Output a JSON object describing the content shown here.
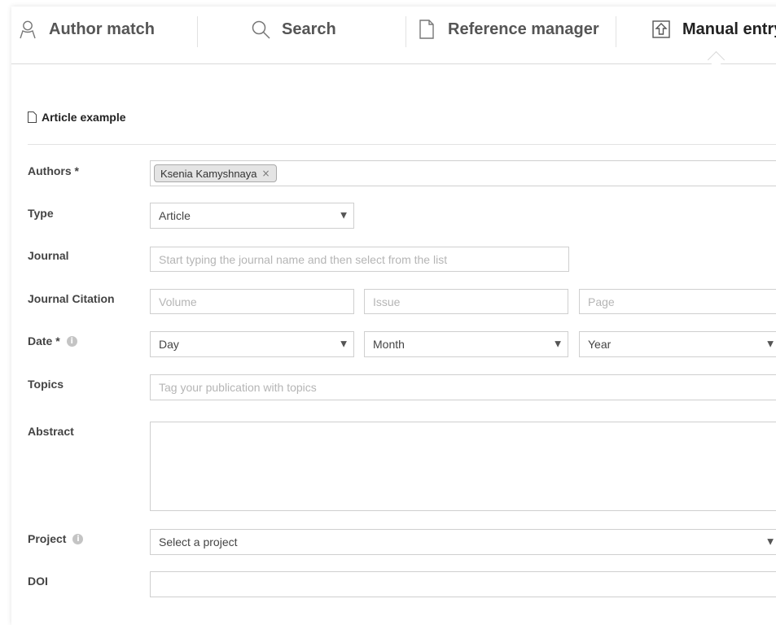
{
  "tabs": [
    {
      "label": "Author match",
      "icon": "person-icon"
    },
    {
      "label": "Search",
      "icon": "search-icon"
    },
    {
      "label": "Reference manager",
      "icon": "document-icon"
    },
    {
      "label": "Manual entry",
      "icon": "upload-icon"
    }
  ],
  "section": {
    "title": "Article example",
    "icon": "document-icon"
  },
  "form": {
    "authors": {
      "label": "Authors *",
      "chip": "Ksenia Kamyshnaya",
      "chip_remove": "×"
    },
    "type": {
      "label": "Type",
      "value": "Article"
    },
    "journal": {
      "label": "Journal",
      "placeholder": "Start typing the journal name and then select from the list"
    },
    "citation": {
      "label": "Journal Citation",
      "volume": "Volume",
      "issue": "Issue",
      "page": "Page"
    },
    "date": {
      "label": "Date *",
      "day": "Day",
      "month": "Month",
      "year": "Year"
    },
    "topics": {
      "label": "Topics",
      "placeholder": "Tag your publication with topics"
    },
    "abstract": {
      "label": "Abstract"
    },
    "project": {
      "label": "Project",
      "value": "Select a project"
    },
    "doi": {
      "label": "DOI"
    }
  },
  "arrow": "▼",
  "info_glyph": "i"
}
